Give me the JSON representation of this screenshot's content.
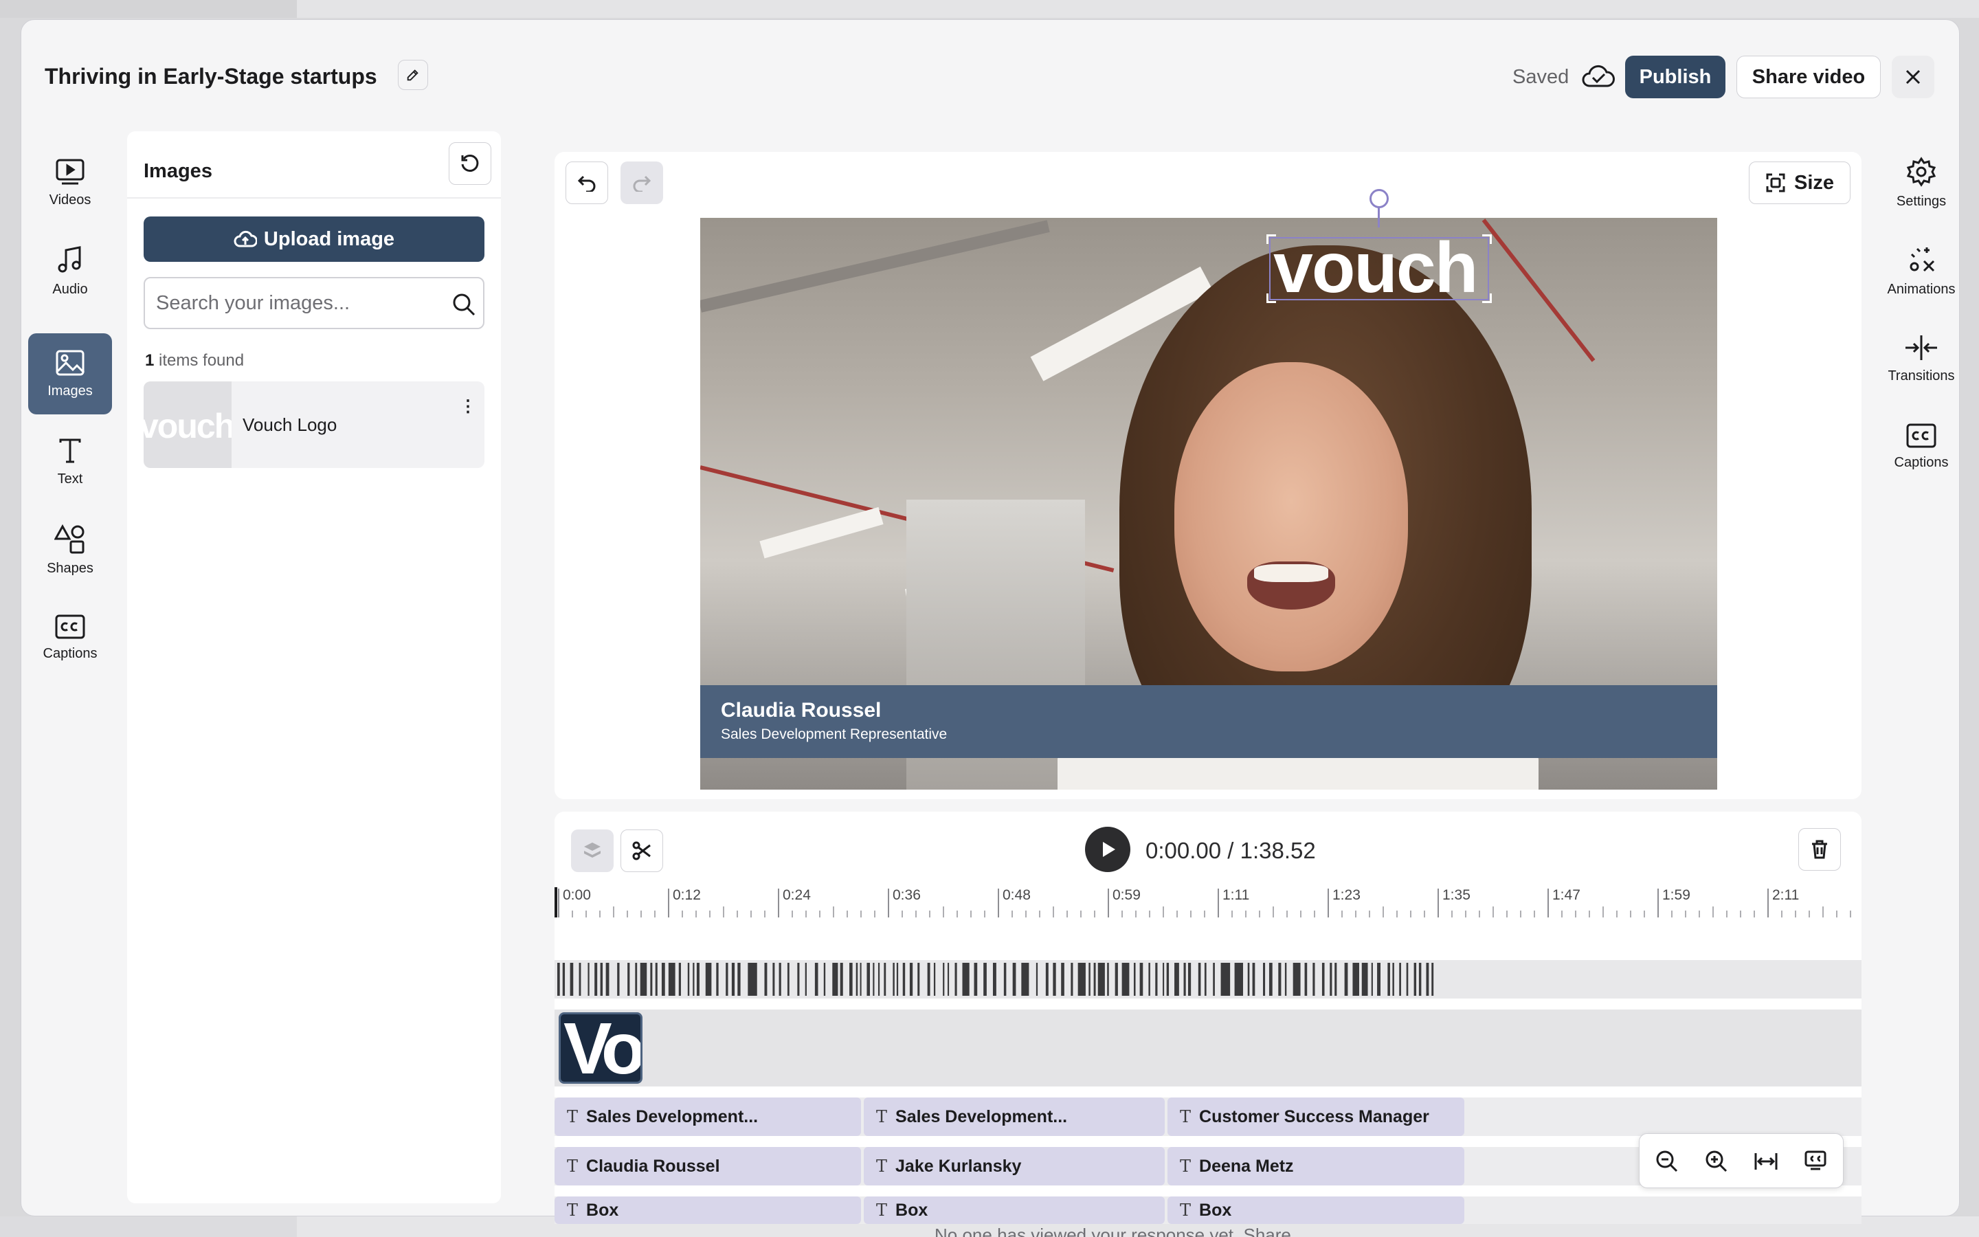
{
  "header": {
    "title": "Thriving in Early-Stage startups",
    "saved_label": "Saved",
    "publish_label": "Publish",
    "share_label": "Share video"
  },
  "left_nav": [
    {
      "label": "Videos",
      "icon": "video-icon"
    },
    {
      "label": "Audio",
      "icon": "music-note-icon"
    },
    {
      "label": "Images",
      "icon": "image-icon",
      "active": true
    },
    {
      "label": "Text",
      "icon": "text-icon"
    },
    {
      "label": "Shapes",
      "icon": "shapes-icon"
    },
    {
      "label": "Captions",
      "icon": "captions-icon"
    }
  ],
  "right_nav": [
    {
      "label": "Settings",
      "icon": "gear-icon"
    },
    {
      "label": "Animations",
      "icon": "animations-icon"
    },
    {
      "label": "Transitions",
      "icon": "transitions-icon"
    },
    {
      "label": "Captions",
      "icon": "captions-icon"
    }
  ],
  "images_panel": {
    "title": "Images",
    "upload_label": "Upload image",
    "search_placeholder": "Search your images...",
    "found_count": "1",
    "found_label": "items found",
    "items": [
      {
        "name": "Vouch Logo",
        "thumb_text": "vouch"
      }
    ]
  },
  "stage": {
    "size_label": "Size",
    "logo_text": "vouch",
    "lower_third_name": "Claudia Roussel",
    "lower_third_title": "Sales Development Representative"
  },
  "timeline": {
    "current_time": "0:00.00 / 1:38.52",
    "ticks": [
      "0:00",
      "0:12",
      "0:24",
      "0:36",
      "0:48",
      "0:59",
      "1:11",
      "1:23",
      "1:35",
      "1:47",
      "1:59",
      "2:11"
    ],
    "image_clip_text": "Vo",
    "title_track": [
      "Sales Development...",
      "Sales Development...",
      "Customer Success Manager"
    ],
    "name_track": [
      "Claudia Roussel",
      "Jake Kurlansky",
      "Deena Metz"
    ],
    "box_track": [
      "Box",
      "Box",
      "Box"
    ]
  },
  "background_text": "No one has viewed your response yet. Share",
  "colors": {
    "primary": "#324862",
    "active_nav": "#4d6380",
    "selection": "#8b82c7",
    "text_clip": "#d8d6ea"
  }
}
